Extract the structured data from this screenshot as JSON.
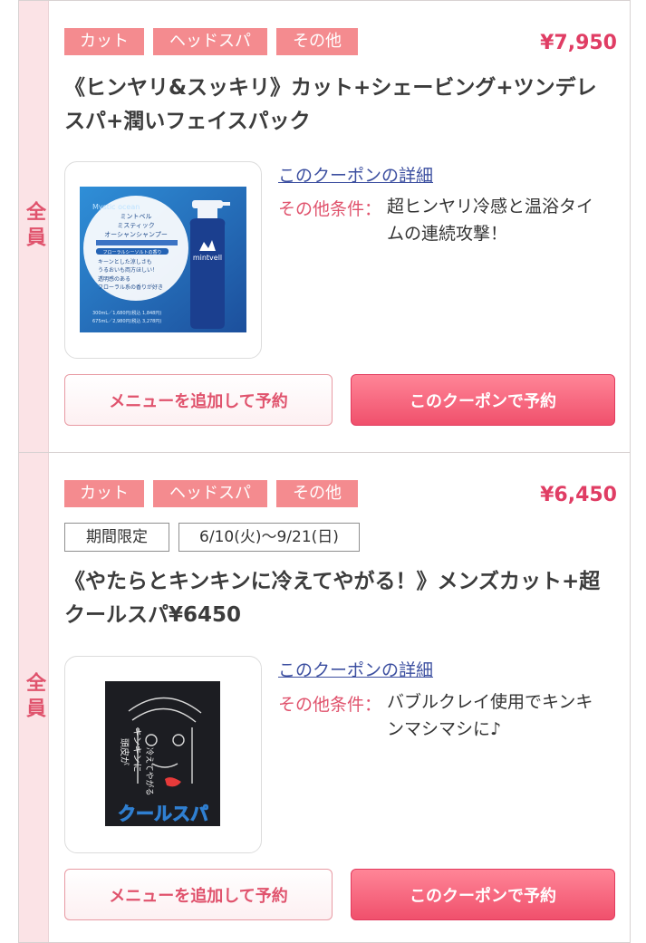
{
  "coupons": [
    {
      "target": "全員",
      "tags": [
        "カット",
        "ヘッドスパ",
        "その他"
      ],
      "price": "¥7,950",
      "title": "《ヒンヤリ&スッキリ》カット+シェービング+ツンデレスパ+潤いフェイスパック",
      "detail_link": "このクーポンの詳細",
      "condition_label": "その他条件：",
      "condition_text": "超ヒンヤリ冷感と温浴タイムの連続攻撃！",
      "menu_button": "メニューを追加して予約",
      "reserve_button": "このクーポンで予約",
      "image_text": {
        "brand_arc": "Mystic ocean",
        "name1": "ミントベル",
        "name2": "ミスティック",
        "name3": "オーシャンシャンプー",
        "scent": "フローラルシーソルトの香り",
        "bullet1": "キーンとした涼しさも",
        "bullet2": "うるおいも両方ほしい！",
        "bullet3": "透明感のある",
        "bullet4": "フローラル系の香りが好き",
        "price1": "300mL／1,680円(税込 1,848円)",
        "price2": "675mL／2,980円(税込 3,278円)",
        "bottle_label": "mintvell"
      }
    },
    {
      "target": "全員",
      "tags": [
        "カット",
        "ヘッドスパ",
        "その他"
      ],
      "price": "¥6,450",
      "period_label": "期間限定",
      "period_dates": "6/10(火)〜9/21(日)",
      "title": "《やたらとキンキンに冷えてやがる！》メンズカット+超クールスパ¥6450",
      "detail_link": "このクーポンの詳細",
      "condition_label": "その他条件：",
      "condition_text": "バブルクレイ使用でキンキンマシマシに♪",
      "menu_button": "メニューを追加して予約",
      "reserve_button": "このクーポンで予約",
      "image_text": {
        "line1": "頭皮が",
        "line2": "キンキンに",
        "line3": "冷えてやがる",
        "banner": "クールスパ"
      }
    }
  ]
}
